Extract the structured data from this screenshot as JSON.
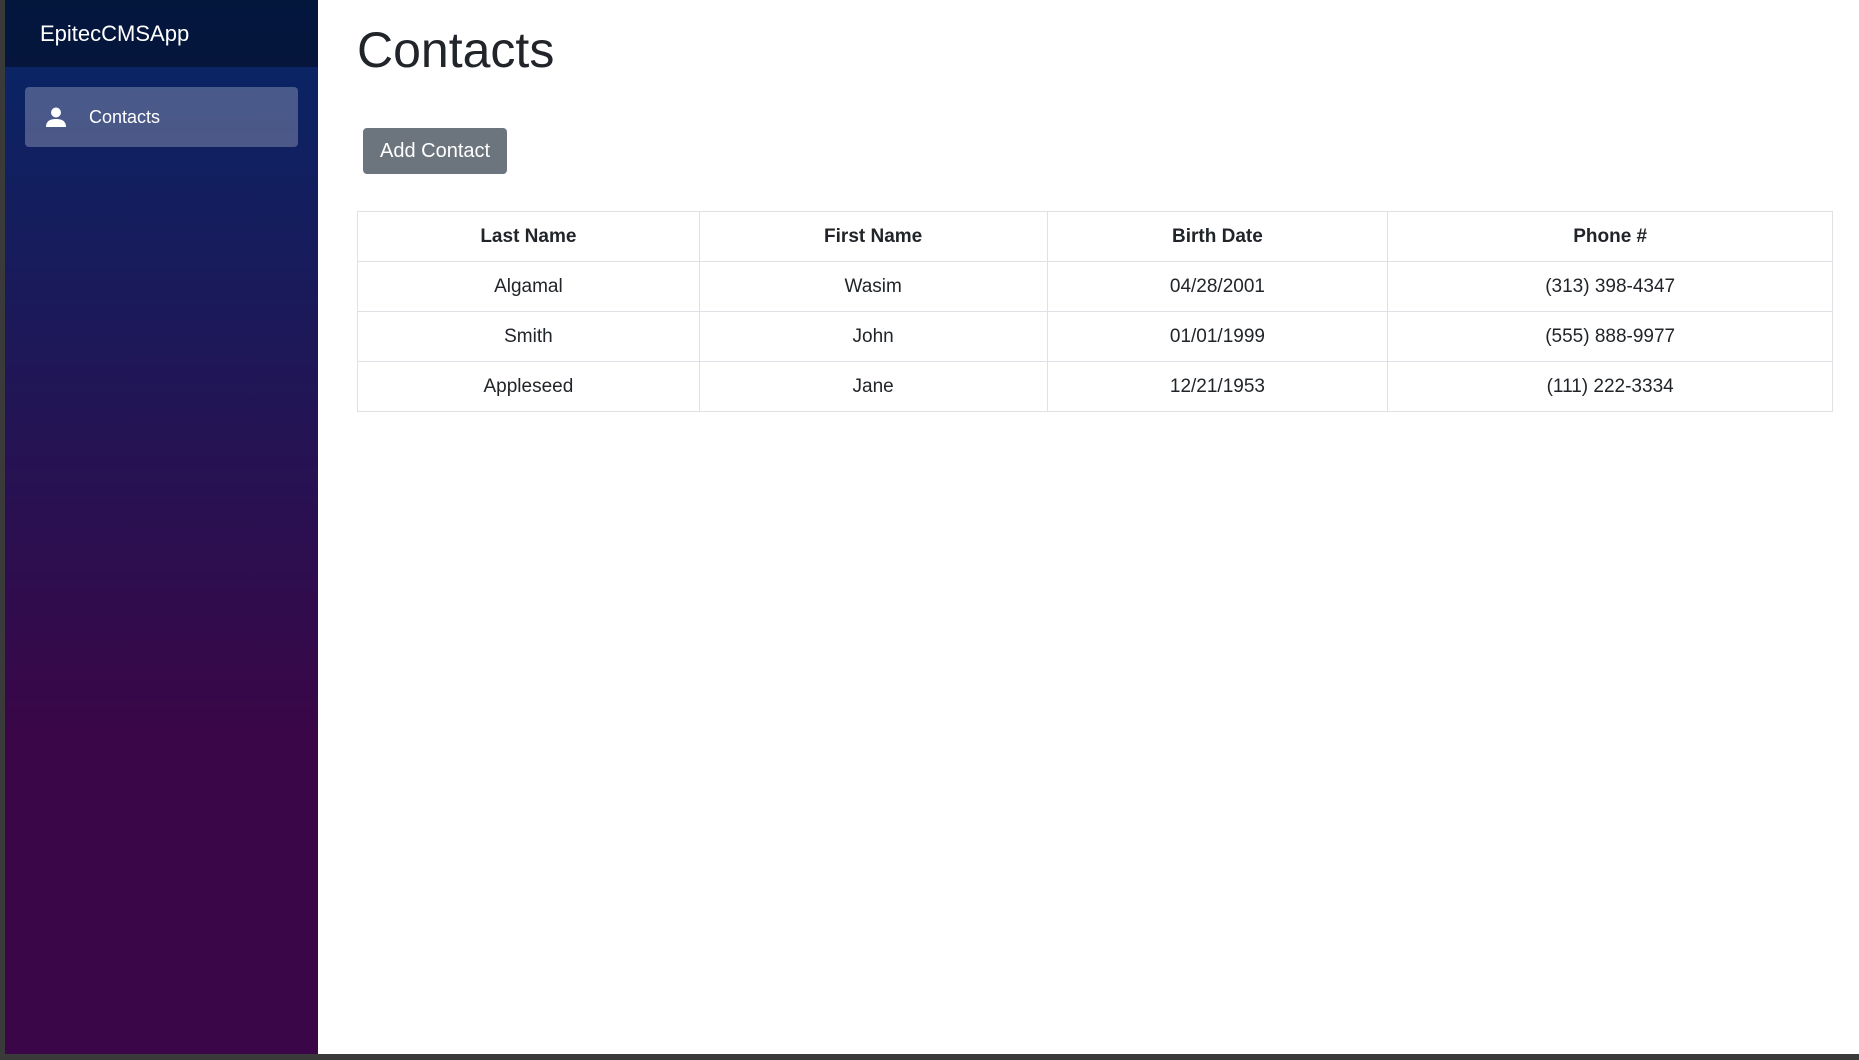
{
  "app": {
    "brand": "EpitecCMSApp"
  },
  "sidebar": {
    "items": [
      {
        "label": "Contacts",
        "icon": "person-icon",
        "active": true
      }
    ]
  },
  "main": {
    "title": "Contacts",
    "add_button_label": "Add Contact",
    "table": {
      "columns": [
        "Last Name",
        "First Name",
        "Birth Date",
        "Phone #"
      ],
      "rows": [
        [
          "Algamal",
          "Wasim",
          "04/28/2001",
          "(313) 398-4347"
        ],
        [
          "Smith",
          "John",
          "01/01/1999",
          "(555) 888-9977"
        ],
        [
          "Appleseed",
          "Jane",
          "12/21/1953",
          "(111) 222-3334"
        ]
      ]
    }
  },
  "colors": {
    "sidebar_top": "#052767",
    "sidebar_bottom": "#3a0647",
    "button": "#6c757d",
    "table_border": "#dee2e6",
    "text": "#212529"
  }
}
